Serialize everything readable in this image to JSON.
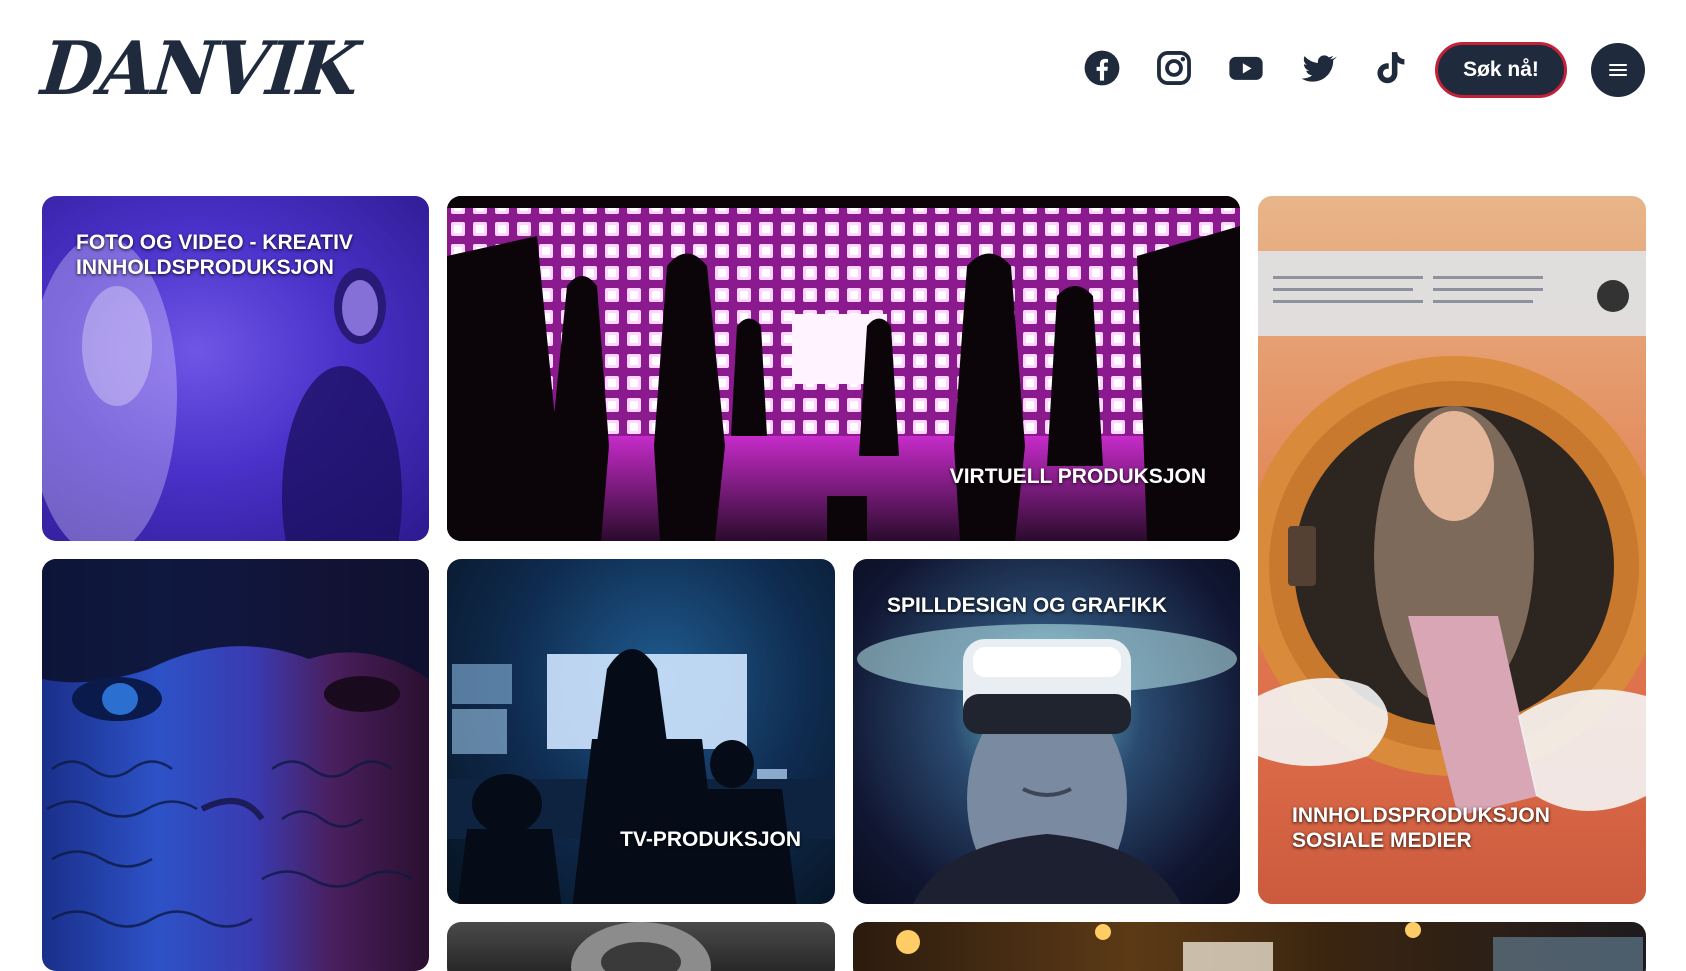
{
  "brand": {
    "logo_text": "DANVIK"
  },
  "header": {
    "social": [
      {
        "name": "Facebook",
        "icon": "facebook-icon"
      },
      {
        "name": "Instagram",
        "icon": "instagram-icon"
      },
      {
        "name": "YouTube",
        "icon": "youtube-icon"
      },
      {
        "name": "Twitter",
        "icon": "twitter-icon"
      },
      {
        "name": "TikTok",
        "icon": "tiktok-icon"
      }
    ],
    "cta_label": "Søk nå!",
    "menu_icon": "hamburger-menu-icon"
  },
  "cards": [
    {
      "id": "foto",
      "title": "FOTO OG VIDEO - KREATIV\nINNHOLDSPRODUKSJON"
    },
    {
      "id": "virtuell",
      "title": "VIRTUELL PRODUKSJON"
    },
    {
      "id": "sosiale",
      "title": "INNHOLDSPRODUKSJON\nSOSIALE MEDIER"
    },
    {
      "id": "face",
      "title": ""
    },
    {
      "id": "tv",
      "title": "TV-PRODUKSJON"
    },
    {
      "id": "spill",
      "title": "SPILLDESIGN OG GRAFIKK"
    },
    {
      "id": "bw",
      "title": ""
    },
    {
      "id": "bar",
      "title": ""
    }
  ],
  "colors": {
    "navy": "#1f2b3d",
    "cta_border": "#c3203a",
    "white": "#ffffff"
  }
}
